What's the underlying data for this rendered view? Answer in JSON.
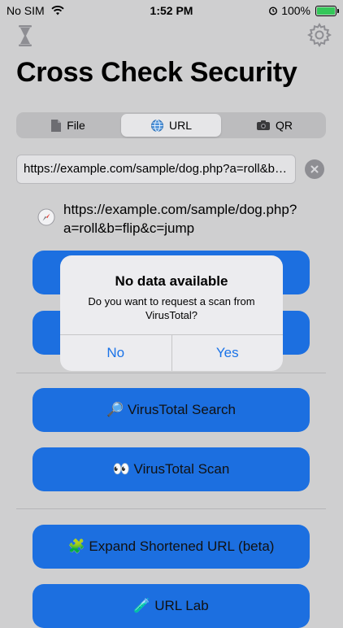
{
  "status_bar": {
    "carrier": "No SIM",
    "time": "1:52 PM",
    "battery": "100%"
  },
  "title": "Cross Check Security",
  "tabs": [
    {
      "label": "File",
      "icon": "file-icon"
    },
    {
      "label": "URL",
      "icon": "globe-icon"
    },
    {
      "label": "QR",
      "icon": "camera-icon"
    }
  ],
  "url_field": {
    "value": "https://example.com/sample/dog.php?a=roll&b=flip&c=jump"
  },
  "url_display": "https://example.com/sample/dog.php?a=roll&b=flip&c=jump",
  "buttons": {
    "virustotal_search": "🔎 VirusTotal Search",
    "virustotal_scan": "👀 VirusTotal Scan",
    "expand_url": "🧩 Expand Shortened URL (beta)",
    "url_lab": "🧪 URL Lab"
  },
  "alert": {
    "title": "No data available",
    "message": "Do you want to request a scan from VirusTotal?",
    "no_label": "No",
    "yes_label": "Yes"
  },
  "colors": {
    "accent": "#1c6fe0",
    "background": "#cfcfd0",
    "alert_link": "#1a73e8"
  }
}
